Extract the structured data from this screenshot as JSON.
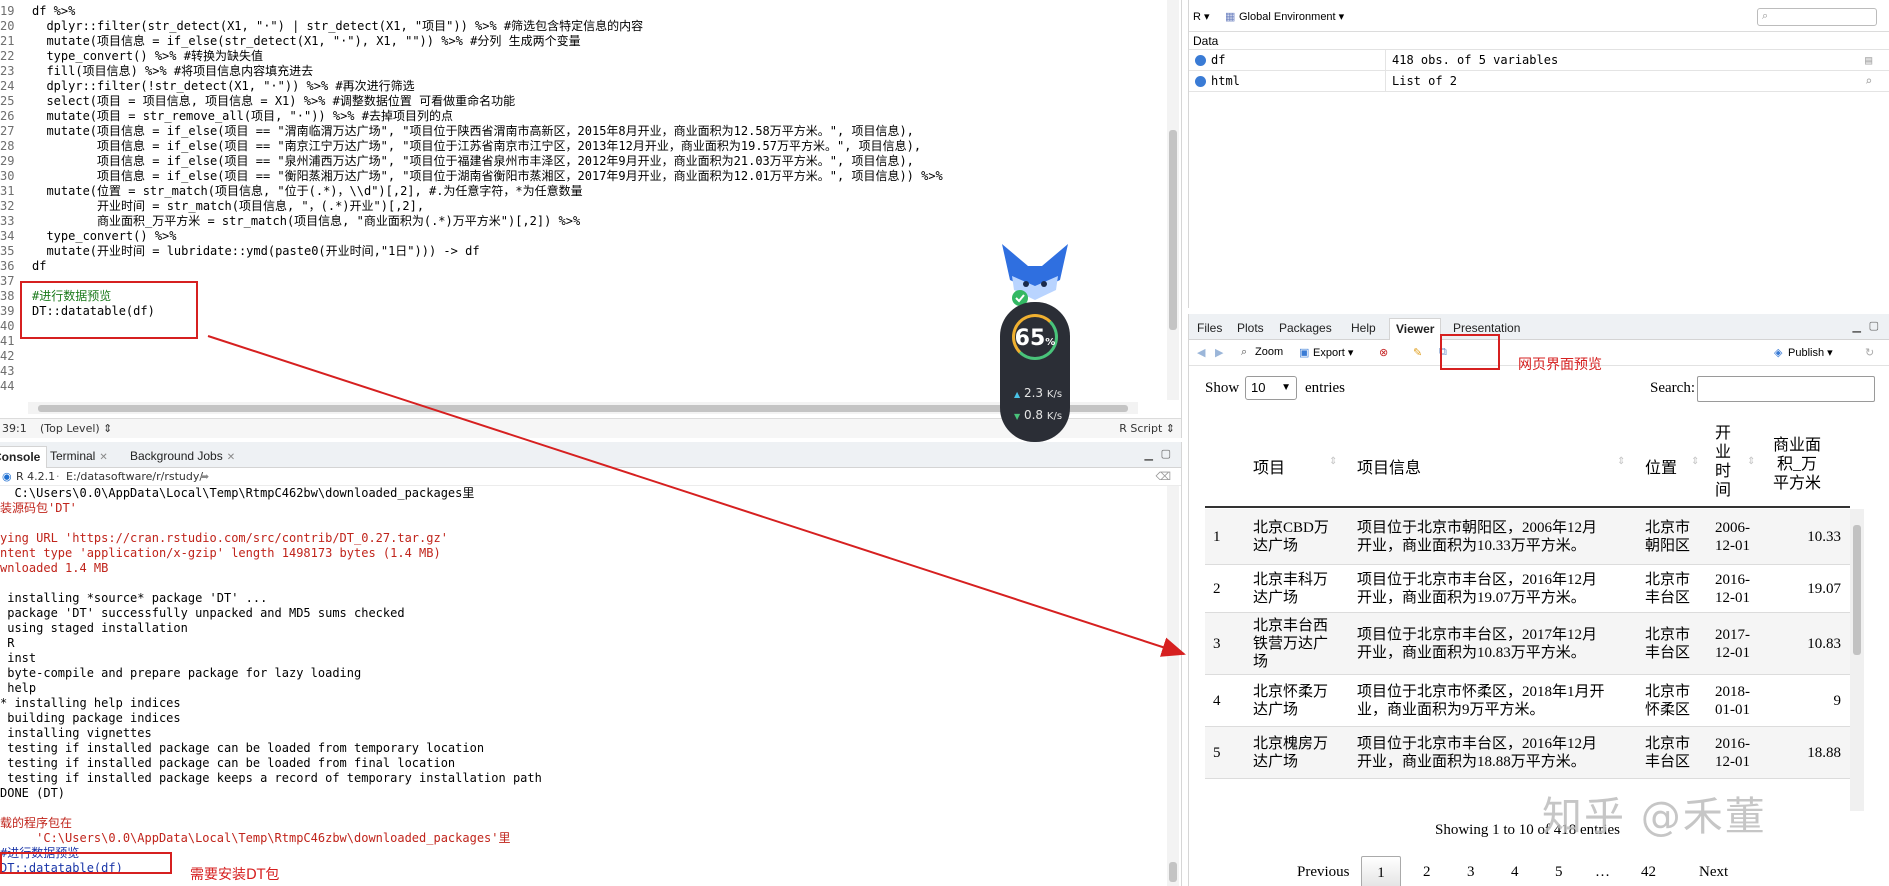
{
  "editor": {
    "line_numbers": [
      "19",
      "20",
      "21",
      "22",
      "23",
      "24",
      "25",
      "26",
      "27",
      "28",
      "29",
      "30",
      "31",
      "32",
      "33",
      "34",
      "35",
      "36",
      "37",
      "38",
      "39",
      "40",
      "41",
      "42",
      "43",
      "44"
    ],
    "lines": [
      "df %>%",
      "  dplyr::filter(str_detect(X1, \"·\") | str_detect(X1, \"项目\")) %>% #筛选包含特定信息的内容",
      "  mutate(项目信息 = if_else(str_detect(X1, \"·\"), X1, \"\")) %>% #分列 生成两个变量",
      "  type_convert() %>% #转换为缺失值",
      "  fill(项目信息) %>% #将项目信息内容填充进去",
      "  dplyr::filter(!str_detect(X1, \"·\")) %>% #再次进行筛选",
      "  select(项目 = 项目信息, 项目信息 = X1) %>% #调整数据位置 可看做重命名功能",
      "  mutate(项目 = str_remove_all(项目, \"·\")) %>% #去掉项目列的点",
      "  mutate(项目信息 = if_else(项目 == \"渭南临渭万达广场\", \"项目位于陕西省渭南市高新区，2015年8月开业，商业面积为12.58万平方米。\", 项目信息),",
      "         项目信息 = if_else(项目 == \"南京江宁万达广场\", \"项目位于江苏省南京市江宁区，2013年12月开业，商业面积为19.57万平方米。\", 项目信息),",
      "         项目信息 = if_else(项目 == \"泉州浦西万达广场\", \"项目位于福建省泉州市丰泽区，2012年9月开业，商业面积为21.03万平方米。\", 项目信息),",
      "         项目信息 = if_else(项目 == \"衡阳蒸湘万达广场\", \"项目位于湖南省衡阳市蒸湘区，2017年9月开业，商业面积为12.01万平方米。\", 项目信息)) %>%",
      "  mutate(位置 = str_match(项目信息, \"位于(.*)，\\\\d\")[,2], #.为任意字符，*为任意数量",
      "         开业时间 = str_match(项目信息, \"，(.*)开业\")[,2],",
      "         商业面积_万平方米 = str_match(项目信息, \"商业面积为(.*)万平方米\")[,2]) %>%",
      "  type_convert() %>%",
      "  mutate(开业时间 = lubridate::ymd(paste0(开业时间,\"1日\"))) -> df",
      "df",
      "",
      "#进行数据预览",
      "DT::datatable(df)",
      "",
      "",
      "",
      "",
      ""
    ],
    "cursor_pos": "39:1",
    "scope": "(Top Level) ⇕",
    "script_type": "R Script ⇕"
  },
  "console": {
    "tabs": [
      "Console",
      "Terminal",
      "Background Jobs"
    ],
    "r_version": "R 4.2.1",
    "path": "E:/datasoftware/r/rstudy/",
    "lines": [
      {
        "t": "  C:\\Users\\0.0\\AppData\\Local\\Temp\\RtmpC462bw\\downloaded_packages里",
        "c": ""
      },
      {
        "t": "装源码包'DT'",
        "c": "red"
      },
      {
        "t": "",
        "c": ""
      },
      {
        "t": "ying URL 'https://cran.rstudio.com/src/contrib/DT_0.27.tar.gz'",
        "c": "red"
      },
      {
        "t": "ntent type 'application/x-gzip' length 1498173 bytes (1.4 MB)",
        "c": "red"
      },
      {
        "t": "wnloaded 1.4 MB",
        "c": "red"
      },
      {
        "t": "",
        "c": ""
      },
      {
        "t": " installing *source* package 'DT' ...",
        "c": ""
      },
      {
        "t": " package 'DT' successfully unpacked and MD5 sums checked",
        "c": ""
      },
      {
        "t": " using staged installation",
        "c": ""
      },
      {
        "t": " R",
        "c": ""
      },
      {
        "t": " inst",
        "c": ""
      },
      {
        "t": " byte-compile and prepare package for lazy loading",
        "c": ""
      },
      {
        "t": " help",
        "c": ""
      },
      {
        "t": "* installing help indices",
        "c": ""
      },
      {
        "t": " building package indices",
        "c": ""
      },
      {
        "t": " installing vignettes",
        "c": ""
      },
      {
        "t": " testing if installed package can be loaded from temporary location",
        "c": ""
      },
      {
        "t": " testing if installed package can be loaded from final location",
        "c": ""
      },
      {
        "t": " testing if installed package keeps a record of temporary installation path",
        "c": ""
      },
      {
        "t": "DONE (DT)",
        "c": ""
      },
      {
        "t": "",
        "c": ""
      },
      {
        "t": "载的程序包在",
        "c": "red"
      },
      {
        "t": "     'C:\\Users\\0.0\\AppData\\Local\\Temp\\RtmpC46zbw\\downloaded_packages'里",
        "c": "red"
      },
      {
        "t": "#进行数据预览",
        "c": "blue"
      },
      {
        "t": "DT::datatable(df)",
        "c": "blue"
      }
    ]
  },
  "environment": {
    "r_selector": "R ▾",
    "env_selector": "Global Environment ▾",
    "section": "Data",
    "rows": [
      {
        "name": "df",
        "value": "418 obs. of 5 variables"
      },
      {
        "name": "html",
        "value": "List of  2"
      }
    ]
  },
  "viewer": {
    "tabs": [
      "Files",
      "Plots",
      "Packages",
      "Help",
      "Viewer",
      "Presentation"
    ],
    "zoom": "Zoom",
    "export": "Export ▾",
    "publish": "Publish ▾",
    "show_label": "Show",
    "page_len": "10",
    "entries_label": "entries",
    "search_label": "Search:",
    "headers": [
      "项目",
      "项目信息",
      "位置",
      "开业时间",
      "商业面积_万平方米"
    ],
    "header_display": {
      "h1": "项目",
      "h2": "项目信息",
      "h3": "位置",
      "h4": [
        "开",
        "业",
        "时",
        "间"
      ],
      "h5": [
        "商业面",
        "积_万",
        "平方米"
      ]
    },
    "rows": [
      {
        "idx": "1",
        "name": [
          "北京CBD万",
          "达广场"
        ],
        "info": [
          "项目位于北京市朝阳区，2006年12月",
          "开业，商业面积为10.33万平方米。"
        ],
        "loc": [
          "北京市",
          "朝阳区"
        ],
        "date": [
          "2006-",
          "12-01"
        ],
        "area": "10.33"
      },
      {
        "idx": "2",
        "name": [
          "北京丰科万",
          "达广场"
        ],
        "info": [
          "项目位于北京市丰台区，2016年12月",
          "开业，商业面积为19.07万平方米。"
        ],
        "loc": [
          "北京市",
          "丰台区"
        ],
        "date": [
          "2016-",
          "12-01"
        ],
        "area": "19.07"
      },
      {
        "idx": "3",
        "name": [
          "北京丰台西",
          "铁营万达广",
          "场"
        ],
        "info": [
          "项目位于北京市丰台区，2017年12月",
          "开业，商业面积为10.83万平方米。"
        ],
        "loc": [
          "北京市",
          "丰台区"
        ],
        "date": [
          "2017-",
          "12-01"
        ],
        "area": "10.83"
      },
      {
        "idx": "4",
        "name": [
          "北京怀柔万",
          "达广场"
        ],
        "info": [
          "项目位于北京市怀柔区，2018年1月开",
          "业，商业面积为9万平方米。"
        ],
        "loc": [
          "北京市",
          "怀柔区"
        ],
        "date": [
          "2018-",
          "01-01"
        ],
        "area": "9"
      },
      {
        "idx": "5",
        "name": [
          "北京槐房万",
          "达广场"
        ],
        "info": [
          "项目位于北京市丰台区，2016年12月",
          "开业，商业面积为18.88万平方米。"
        ],
        "loc": [
          "北京市",
          "丰台区"
        ],
        "date": [
          "2016-",
          "12-01"
        ],
        "area": "18.88"
      }
    ],
    "info_text": "Showing 1 to 10 of 418 entries",
    "pager": [
      "Previous",
      "1",
      "2",
      "3",
      "4",
      "5",
      "…",
      "42",
      "Next"
    ]
  },
  "annotations": {
    "preview_label": "网页界面预览",
    "install_label": "需要安装DT包",
    "color": "#d62020"
  },
  "widget": {
    "percent": "65",
    "percent_sign": "%",
    "up_rate": "2.3",
    "up_unit": "K/s",
    "down_rate": "0.8",
    "down_unit": "K/s"
  },
  "watermark": "知乎 @禾董"
}
